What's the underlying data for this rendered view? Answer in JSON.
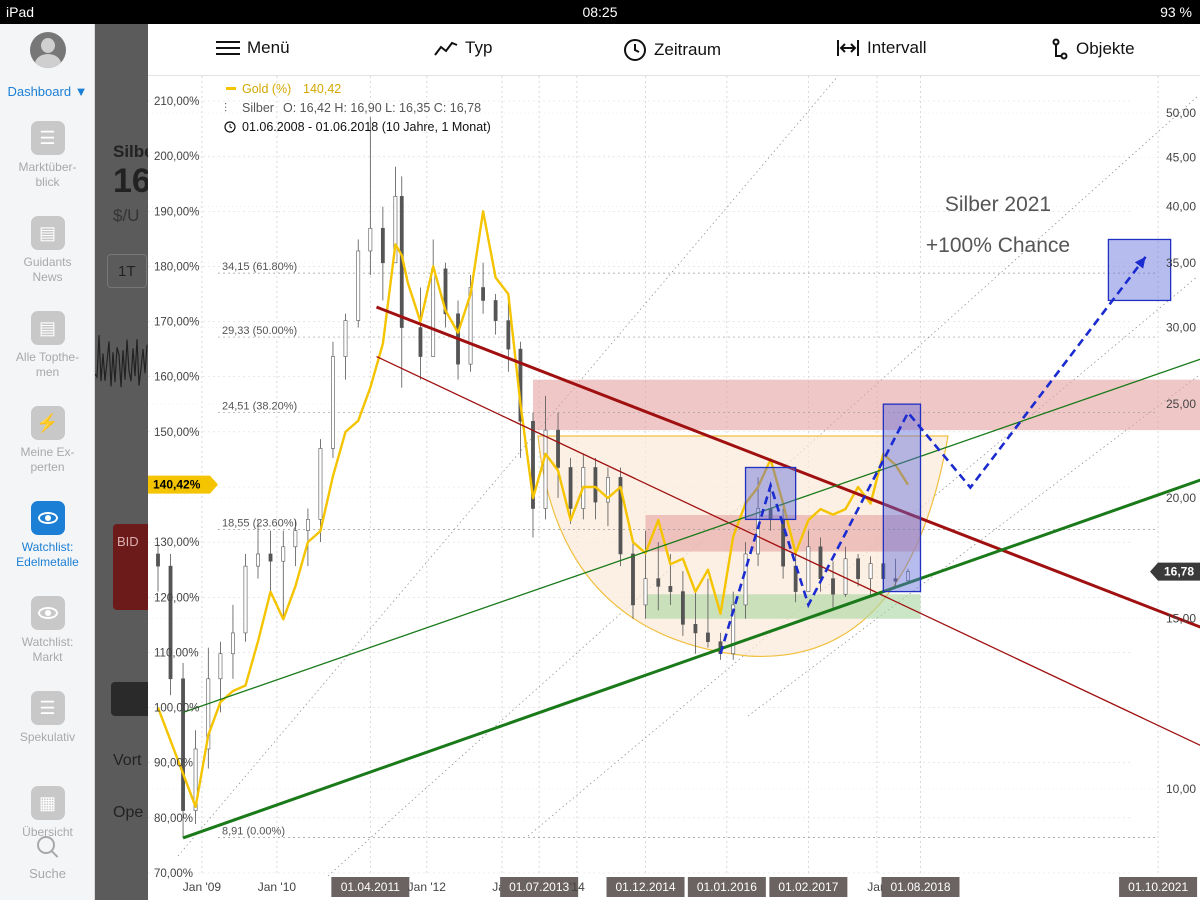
{
  "status": {
    "device": "iPad",
    "time": "08:25",
    "battery": "93 %"
  },
  "sidebar": {
    "dashboard": "Dashboard ▼",
    "items": [
      {
        "label": "Marktüber-\nblick",
        "icon": "list-icon"
      },
      {
        "label": "Guidants\nNews",
        "icon": "newspaper-icon"
      },
      {
        "label": "Alle Topthe-\nmen",
        "icon": "newspaper-icon"
      },
      {
        "label": "Meine Ex-\nperten",
        "icon": "lightning-icon"
      },
      {
        "label": "Watchlist:\nEdelmetalle",
        "icon": "eye-icon",
        "active": true
      },
      {
        "label": "Watchlist:\nMarkt",
        "icon": "eye-icon"
      },
      {
        "label": "Spekulativ",
        "icon": "list-icon"
      },
      {
        "label": "Übersicht",
        "icon": "grid-icon"
      }
    ],
    "search": "Suche"
  },
  "background_app": {
    "title": "Silbe",
    "price": "16",
    "unit": "$/U",
    "period_btn": "1T",
    "bid": "BID",
    "row1": "Vort",
    "row2": "Ope"
  },
  "toolbar": {
    "menu": "Menü",
    "type": "Typ",
    "period": "Zeitraum",
    "interval": "Intervall",
    "objects": "Objekte"
  },
  "chart_data": {
    "type": "line",
    "legend": [
      {
        "label": "Gold (%)",
        "value": "140,42",
        "color": "#f5c400"
      },
      {
        "label": "Silber",
        "value": "O: 16,42   H: 16,90   L: 16,35   C: 16,78",
        "color": "#555555"
      }
    ],
    "range_text": "01.06.2008 - 01.06.2018   (10 Jahre, 1 Monat)",
    "annotation_lines": [
      "Silber 2021",
      "+100% Chance"
    ],
    "left_axis": {
      "label_suffix": "%",
      "ticks": [
        "210,00%",
        "200,00%",
        "190,00%",
        "180,00%",
        "170,00%",
        "160,00%",
        "150,00%",
        "140,00%",
        "130,00%",
        "120,00%",
        "110,00%",
        "100,00%",
        "90,00%",
        "80,00%",
        "70,00%"
      ],
      "values": [
        210,
        200,
        190,
        180,
        170,
        160,
        150,
        140,
        130,
        120,
        110,
        100,
        90,
        80,
        70
      ],
      "current_label": "140,42%",
      "current_value": 140.42
    },
    "right_axis": {
      "scale": "log",
      "ticks": [
        "50,00",
        "45,00",
        "40,00",
        "35,00",
        "30,00",
        "25,00",
        "20,00",
        "15,00",
        "10,00"
      ],
      "values": [
        50,
        45,
        40,
        35,
        30,
        25,
        20,
        15,
        10
      ],
      "current_label": "16,78",
      "current_value": 16.78
    },
    "x_axis": {
      "ticks": [
        {
          "label": "Jan '09",
          "date": "2009-01-01",
          "highlight": false
        },
        {
          "label": "Jan '10",
          "date": "2010-01-01",
          "highlight": false
        },
        {
          "label": "01.04.2011",
          "date": "2011-04-01",
          "highlight": true
        },
        {
          "label": "Jan '12",
          "date": "2012-01-01",
          "highlight": false
        },
        {
          "label": "Jan",
          "date": "2013-01-01",
          "highlight": false
        },
        {
          "label": "01.07.2013",
          "date": "2013-07-01",
          "highlight": true
        },
        {
          "label": "'14",
          "date": "2014-01-01",
          "highlight": false
        },
        {
          "label": "01.12.2014",
          "date": "2014-12-01",
          "highlight": true
        },
        {
          "label": "01.01.2016",
          "date": "2016-01-01",
          "highlight": true
        },
        {
          "label": "01.02.2017",
          "date": "2017-02-01",
          "highlight": true
        },
        {
          "label": "Jan",
          "date": "2018-01-01",
          "highlight": false
        },
        {
          "label": "01.08.2018",
          "date": "2018-08-01",
          "highlight": true
        },
        {
          "label": "01.10.2021",
          "date": "2021-10-01",
          "highlight": true
        }
      ]
    },
    "fib_levels": [
      {
        "label": "34,15 (61.80%)",
        "value": 34.15
      },
      {
        "label": "29,33 (50.00%)",
        "value": 29.33
      },
      {
        "label": "24,51 (38.20%)",
        "value": 24.51
      },
      {
        "label": "18,55 (23.60%)",
        "value": 18.55
      },
      {
        "label": "8,91 (0.00%)",
        "value": 8.91
      }
    ],
    "series": [
      {
        "name": "Gold (%)",
        "color": "#f5c400",
        "points": [
          [
            "2008-06-01",
            100
          ],
          [
            "2008-10-01",
            88
          ],
          [
            "2008-12-01",
            82
          ],
          [
            "2009-02-01",
            95
          ],
          [
            "2009-04-01",
            101
          ],
          [
            "2009-06-01",
            103
          ],
          [
            "2009-08-01",
            104
          ],
          [
            "2009-10-01",
            112
          ],
          [
            "2009-12-01",
            121
          ],
          [
            "2010-02-01",
            116
          ],
          [
            "2010-04-01",
            122
          ],
          [
            "2010-06-01",
            130
          ],
          [
            "2010-08-01",
            132
          ],
          [
            "2010-10-01",
            142
          ],
          [
            "2010-12-01",
            150
          ],
          [
            "2011-02-01",
            152
          ],
          [
            "2011-04-01",
            158
          ],
          [
            "2011-06-01",
            166
          ],
          [
            "2011-08-01",
            184
          ],
          [
            "2011-09-01",
            182
          ],
          [
            "2011-10-01",
            177
          ],
          [
            "2011-12-01",
            170
          ],
          [
            "2012-02-01",
            180
          ],
          [
            "2012-04-01",
            172
          ],
          [
            "2012-06-01",
            168
          ],
          [
            "2012-08-01",
            175
          ],
          [
            "2012-10-01",
            190
          ],
          [
            "2012-12-01",
            178
          ],
          [
            "2013-02-01",
            175
          ],
          [
            "2013-04-01",
            155
          ],
          [
            "2013-06-01",
            138
          ],
          [
            "2013-08-01",
            146
          ],
          [
            "2013-10-01",
            143
          ],
          [
            "2013-12-01",
            134
          ],
          [
            "2014-02-01",
            140
          ],
          [
            "2014-04-01",
            140
          ],
          [
            "2014-06-01",
            138
          ],
          [
            "2014-08-01",
            140
          ],
          [
            "2014-10-01",
            130
          ],
          [
            "2014-12-01",
            128
          ],
          [
            "2015-02-01",
            134
          ],
          [
            "2015-04-01",
            126
          ],
          [
            "2015-06-01",
            127
          ],
          [
            "2015-08-01",
            121
          ],
          [
            "2015-10-01",
            125
          ],
          [
            "2015-12-01",
            117
          ],
          [
            "2016-02-01",
            131
          ],
          [
            "2016-04-01",
            137
          ],
          [
            "2016-06-01",
            140
          ],
          [
            "2016-08-01",
            145
          ],
          [
            "2016-10-01",
            137
          ],
          [
            "2016-12-01",
            128
          ],
          [
            "2017-02-01",
            134
          ],
          [
            "2017-04-01",
            136
          ],
          [
            "2017-06-01",
            135
          ],
          [
            "2017-08-01",
            136
          ],
          [
            "2017-10-01",
            140
          ],
          [
            "2017-12-01",
            137
          ],
          [
            "2018-02-01",
            146
          ],
          [
            "2018-04-01",
            144
          ],
          [
            "2018-06-01",
            140.42
          ]
        ]
      },
      {
        "name": "Silber",
        "color": "#555555",
        "candles": [
          [
            "2008-06-01",
            17.5,
            17.9,
            16.0,
            17.0
          ],
          [
            "2008-08-01",
            17.0,
            17.5,
            12.5,
            13.0
          ],
          [
            "2008-10-01",
            13.0,
            13.5,
            8.9,
            9.5
          ],
          [
            "2008-12-01",
            9.5,
            11.5,
            9.2,
            11.0
          ],
          [
            "2009-02-01",
            11.0,
            14.0,
            10.5,
            13.0
          ],
          [
            "2009-04-01",
            13.0,
            14.2,
            12.0,
            13.8
          ],
          [
            "2009-06-01",
            13.8,
            15.5,
            13.0,
            14.5
          ],
          [
            "2009-08-01",
            14.5,
            17.5,
            14.2,
            17.0
          ],
          [
            "2009-10-01",
            17.0,
            19.0,
            16.5,
            17.5
          ],
          [
            "2009-12-01",
            17.5,
            18.5,
            16.0,
            17.2
          ],
          [
            "2010-02-01",
            17.2,
            18.5,
            15.0,
            17.8
          ],
          [
            "2010-04-01",
            17.8,
            19.0,
            17.0,
            18.5
          ],
          [
            "2010-06-01",
            18.5,
            19.5,
            17.0,
            19.0
          ],
          [
            "2010-08-01",
            19.0,
            23.0,
            18.0,
            22.5
          ],
          [
            "2010-10-01",
            22.5,
            29.0,
            22.0,
            28.0
          ],
          [
            "2010-12-01",
            28.0,
            31.0,
            26.5,
            30.5
          ],
          [
            "2011-02-01",
            30.5,
            37.0,
            30.0,
            36.0
          ],
          [
            "2011-04-01",
            36.0,
            49.5,
            34.0,
            38.0
          ],
          [
            "2011-06-01",
            38.0,
            40.0,
            32.0,
            35.0
          ],
          [
            "2011-08-01",
            35.0,
            44.0,
            35.0,
            41.0
          ],
          [
            "2011-09-01",
            41.0,
            43.0,
            26.0,
            30.0
          ],
          [
            "2011-12-01",
            30.0,
            33.0,
            26.5,
            28.0
          ],
          [
            "2012-02-01",
            28.0,
            37.0,
            28.0,
            34.5
          ],
          [
            "2012-04-01",
            34.5,
            35.0,
            30.0,
            31.0
          ],
          [
            "2012-06-01",
            31.0,
            32.0,
            26.5,
            27.5
          ],
          [
            "2012-08-01",
            27.5,
            34.0,
            27.0,
            33.0
          ],
          [
            "2012-10-01",
            33.0,
            35.0,
            31.0,
            32.0
          ],
          [
            "2012-12-01",
            32.0,
            32.5,
            29.5,
            30.5
          ],
          [
            "2013-02-01",
            30.5,
            32.0,
            27.0,
            28.5
          ],
          [
            "2013-04-01",
            28.5,
            29.0,
            22.0,
            24.0
          ],
          [
            "2013-06-01",
            24.0,
            24.5,
            18.2,
            19.5
          ],
          [
            "2013-08-01",
            19.5,
            25.5,
            19.0,
            23.5
          ],
          [
            "2013-10-01",
            23.5,
            24.5,
            20.0,
            21.5
          ],
          [
            "2013-12-01",
            21.5,
            22.0,
            18.8,
            19.5
          ],
          [
            "2014-02-01",
            19.5,
            22.2,
            19.0,
            21.5
          ],
          [
            "2014-04-01",
            21.5,
            22.0,
            19.0,
            19.8
          ],
          [
            "2014-06-01",
            19.8,
            21.5,
            18.7,
            21.0
          ],
          [
            "2014-08-01",
            21.0,
            21.5,
            17.0,
            17.5
          ],
          [
            "2014-10-01",
            17.5,
            18.0,
            15.0,
            15.5
          ],
          [
            "2014-12-01",
            15.5,
            18.5,
            15.0,
            16.5
          ],
          [
            "2015-02-01",
            16.5,
            18.0,
            15.3,
            16.2
          ],
          [
            "2015-04-01",
            16.2,
            17.5,
            15.5,
            16.0
          ],
          [
            "2015-06-01",
            16.0,
            16.8,
            14.4,
            14.8
          ],
          [
            "2015-08-01",
            14.8,
            16.0,
            13.8,
            14.5
          ],
          [
            "2015-10-01",
            14.5,
            16.5,
            14.0,
            14.2
          ],
          [
            "2015-12-01",
            14.2,
            14.5,
            13.6,
            13.8
          ],
          [
            "2016-02-01",
            13.8,
            16.0,
            13.6,
            15.5
          ],
          [
            "2016-04-01",
            15.5,
            18.0,
            15.0,
            17.5
          ],
          [
            "2016-06-01",
            17.5,
            21.0,
            17.0,
            19.5
          ],
          [
            "2016-08-01",
            19.5,
            20.5,
            18.5,
            19.0
          ],
          [
            "2016-10-01",
            19.0,
            19.5,
            16.5,
            17.0
          ],
          [
            "2016-12-01",
            17.0,
            17.5,
            15.6,
            16.0
          ],
          [
            "2017-02-01",
            16.0,
            18.5,
            16.0,
            17.8
          ],
          [
            "2017-04-01",
            17.8,
            18.2,
            16.0,
            16.5
          ],
          [
            "2017-06-01",
            16.5,
            17.2,
            15.4,
            15.9
          ],
          [
            "2017-08-01",
            15.9,
            17.8,
            15.8,
            17.3
          ],
          [
            "2017-10-01",
            17.3,
            17.5,
            16.2,
            16.5
          ],
          [
            "2017-12-01",
            16.5,
            17.4,
            15.8,
            17.1
          ],
          [
            "2018-02-01",
            17.1,
            17.3,
            16.2,
            16.5
          ],
          [
            "2018-04-01",
            16.5,
            17.3,
            16.2,
            16.4
          ],
          [
            "2018-06-01",
            16.42,
            16.9,
            16.35,
            16.78
          ]
        ]
      }
    ],
    "trend_lines": [
      {
        "name": "red-downtrend-main",
        "color": "#a01010",
        "from": [
          "2011-05-01",
          31.5
        ],
        "to": [
          "2022-06-01",
          14.6
        ]
      },
      {
        "name": "red-downtrend-thin",
        "color": "#a01010",
        "from": [
          "2011-05-01",
          28.0
        ],
        "to": [
          "2022-06-01",
          11.0
        ]
      },
      {
        "name": "green-support-main",
        "color": "#1a7a1a",
        "from": [
          "2008-10-01",
          8.9
        ],
        "to": [
          "2022-06-01",
          21.0
        ]
      },
      {
        "name": "green-channel-thin",
        "color": "#1a7a1a",
        "from": [
          "2008-10-01",
          12.0
        ],
        "to": [
          "2022-06-01",
          28.0
        ]
      }
    ],
    "zones": [
      {
        "name": "resistance-zone",
        "color": "#e6a1a1",
        "y": [
          23.5,
          26.5
        ],
        "x": [
          "2013-06-01",
          "2022-06-01"
        ]
      },
      {
        "name": "resistance-zone-2",
        "color": "#e6a1a1",
        "y": [
          17.6,
          19.2
        ],
        "x": [
          "2014-12-01",
          "2018-08-01"
        ]
      },
      {
        "name": "support-zone",
        "color": "#a8d5a0",
        "y": [
          15.0,
          15.9
        ],
        "x": [
          "2014-12-01",
          "2018-08-01"
        ]
      }
    ],
    "target_boxes": [
      {
        "name": "box-2016",
        "x": [
          "2016-04-01",
          "2016-12-01"
        ],
        "y": [
          19.0,
          21.5
        ]
      },
      {
        "name": "box-2018",
        "x": [
          "2018-02-01",
          "2018-08-01"
        ],
        "y": [
          16.0,
          25.0
        ]
      },
      {
        "name": "box-2021",
        "x": [
          "2021-02-01",
          "2021-12-01"
        ],
        "y": [
          32.0,
          37.0
        ]
      }
    ],
    "projection_path": [
      [
        "2015-12-01",
        13.8
      ],
      [
        "2016-08-01",
        20.6
      ],
      [
        "2017-02-01",
        15.5
      ],
      [
        "2018-06-01",
        24.5
      ],
      [
        "2019-04-01",
        20.5
      ],
      [
        "2021-08-01",
        35.5
      ]
    ]
  }
}
